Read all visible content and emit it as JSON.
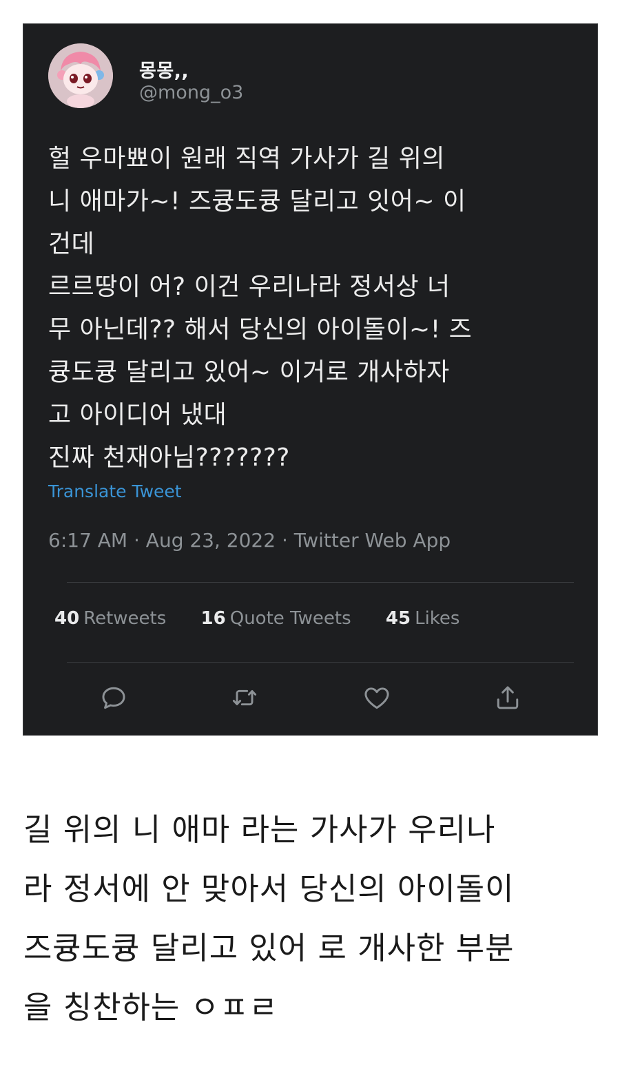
{
  "tweet": {
    "display_name": "몽몽,,",
    "handle": "@mong_o3",
    "body_lines": [
      "헐 우마뾰이 원래 직역 가사가 길 위의",
      "니 애마가~! 즈큥도큥 달리고 잇어~ 이",
      "건데",
      "르르땅이 어? 이건 우리나라 정서상 너",
      "무 아닌데?? 해서 당신의 아이돌이~! 즈",
      "큥도큥 달리고 있어~ 이거로 개사하자",
      "고 아이디어 냈대",
      "진짜 천재아님???????"
    ],
    "translate_label": "Translate Tweet",
    "meta": "6:17 AM · Aug 23, 2022 · Twitter Web App",
    "stats": {
      "retweets": {
        "count": "40",
        "label": "Retweets"
      },
      "quotes": {
        "count": "16",
        "label": "Quote Tweets"
      },
      "likes": {
        "count": "45",
        "label": "Likes"
      }
    },
    "actions": {
      "reply_icon": "reply-icon",
      "retweet_icon": "retweet-icon",
      "like_icon": "heart-icon",
      "share_icon": "share-icon"
    },
    "colors": {
      "card_bg": "#1d1e20",
      "link": "#3a94d6",
      "muted": "#8d9296"
    }
  },
  "caption": {
    "lines": [
      "길 위의 니 애마 라는 가사가 우리나",
      "라 정서에 안 맞아서 당신의 아이돌이",
      "즈큥도큥 달리고 있어 로 개사한 부분",
      "을 칭찬하는 ㅇㅍㄹ"
    ]
  }
}
